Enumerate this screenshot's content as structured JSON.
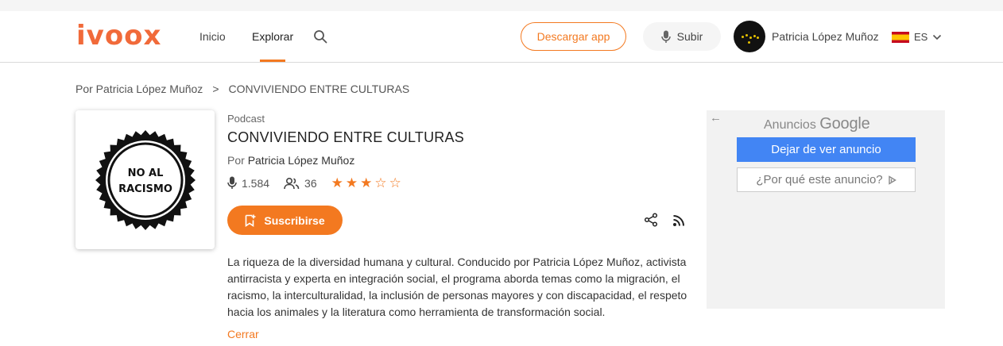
{
  "header": {
    "logo": "ivoox",
    "nav": {
      "inicio": "Inicio",
      "explorar": "Explorar"
    },
    "download_label": "Descargar app",
    "upload_label": "Subir",
    "user_name": "Patricia López Muñoz",
    "language": "ES"
  },
  "breadcrumb": {
    "parent": "Por Patricia López Muñoz",
    "separator": ">",
    "current": "CONVIVIENDO ENTRE CULTURAS"
  },
  "podcast": {
    "cover_text_line1": "NO AL",
    "cover_text_line2": "RACISMO",
    "type": "Podcast",
    "title": "CONVIVIENDO ENTRE CULTURAS",
    "author_prefix": "Por",
    "author": "Patricia López Muñoz",
    "plays": "1.584",
    "subscribers": "36",
    "rating": 3,
    "rating_max": 5,
    "subscribe_label": "Suscribirse",
    "description": "La riqueza de la diversidad humana y cultural. Conducido por Patricia López Muñoz, activista antirracista y experta en integración social, el programa aborda temas como la migración, el racismo, la interculturalidad, la inclusión de personas mayores y con discapacidad, el respeto hacia los animales y la literatura como herramienta de transformación social.",
    "close_label": "Cerrar"
  },
  "ad": {
    "label_prefix": "Anuncios",
    "label_brand": "Google",
    "stop_label": "Dejar de ver anuncio",
    "why_label": "¿Por qué este anuncio?"
  },
  "colors": {
    "accent": "#f37920",
    "logo": "#f16a3a",
    "ad_blue": "#4285f4"
  }
}
